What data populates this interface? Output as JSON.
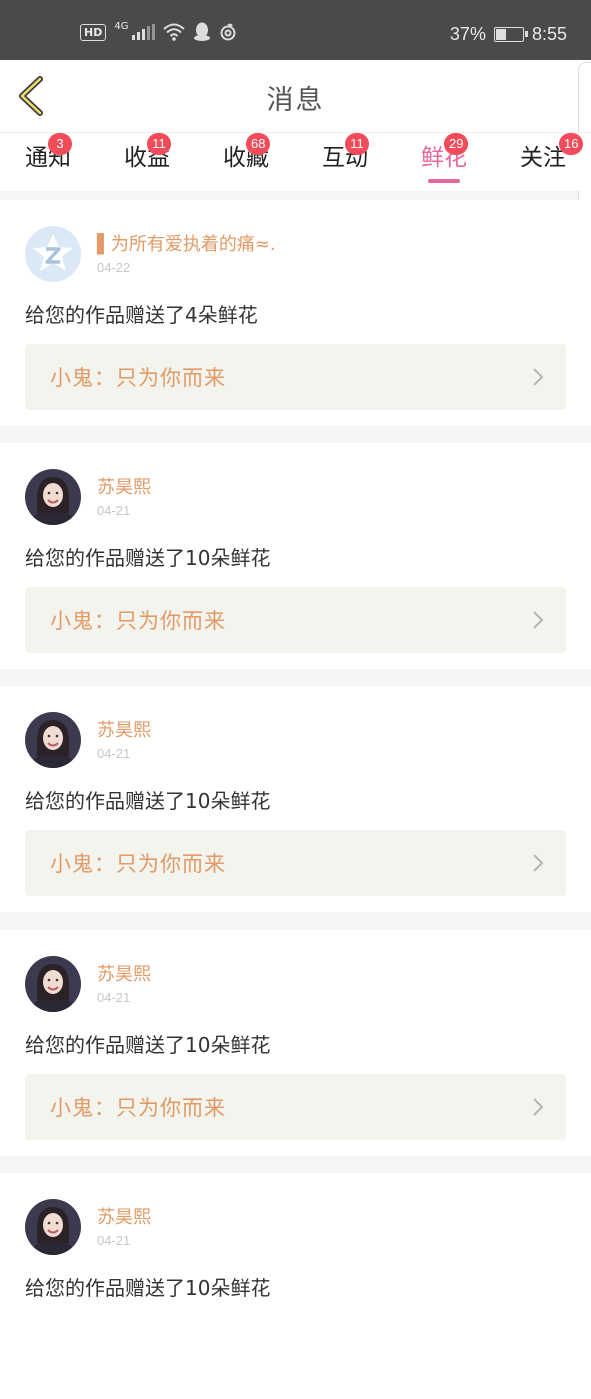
{
  "status_bar": {
    "left_icons": [
      "hd-icon",
      "signal-4g-icon",
      "wifi-icon",
      "qq-icon",
      "netease-music-icon"
    ],
    "hd": "HD",
    "network": "4G",
    "battery": "37%",
    "battery_level": 0.37,
    "time": "8:55"
  },
  "header": {
    "back_icon": "chevron-left-icon",
    "title": "消息"
  },
  "tabs": [
    {
      "label": "通知",
      "badge": "3",
      "active": false
    },
    {
      "label": "收益",
      "badge": "11",
      "active": false
    },
    {
      "label": "收藏",
      "badge": "68",
      "active": false
    },
    {
      "label": "互动",
      "badge": "11",
      "active": false
    },
    {
      "label": "鲜花",
      "badge": "29",
      "active": true
    },
    {
      "label": "关注",
      "badge": "16",
      "active": false
    }
  ],
  "messages": [
    {
      "name": "▌为所有爱执着的痛≈.",
      "date": "04-22",
      "text": "给您的作品赠送了4朵鲜花",
      "work_title": "小鬼：只为你而来",
      "avatar": "default-z-avatar"
    },
    {
      "name": "苏昊熙",
      "date": "04-21",
      "text": "给您的作品赠送了10朵鲜花",
      "work_title": "小鬼：只为你而来",
      "avatar": "photo-avatar"
    },
    {
      "name": "苏昊熙",
      "date": "04-21",
      "text": "给您的作品赠送了10朵鲜花",
      "work_title": "小鬼：只为你而来",
      "avatar": "photo-avatar"
    },
    {
      "name": "苏昊熙",
      "date": "04-21",
      "text": "给您的作品赠送了10朵鲜花",
      "work_title": "小鬼：只为你而来",
      "avatar": "photo-avatar"
    },
    {
      "name": "苏昊熙",
      "date": "04-21",
      "text": "给您的作品赠送了10朵鲜花",
      "work_title": "小鬼：只为你而来",
      "avatar": "photo-avatar"
    }
  ],
  "colors": {
    "accent": "#e7679c",
    "badge": "#f24b5a",
    "name": "#e29a66",
    "status_bar": "#4a4a4a"
  }
}
